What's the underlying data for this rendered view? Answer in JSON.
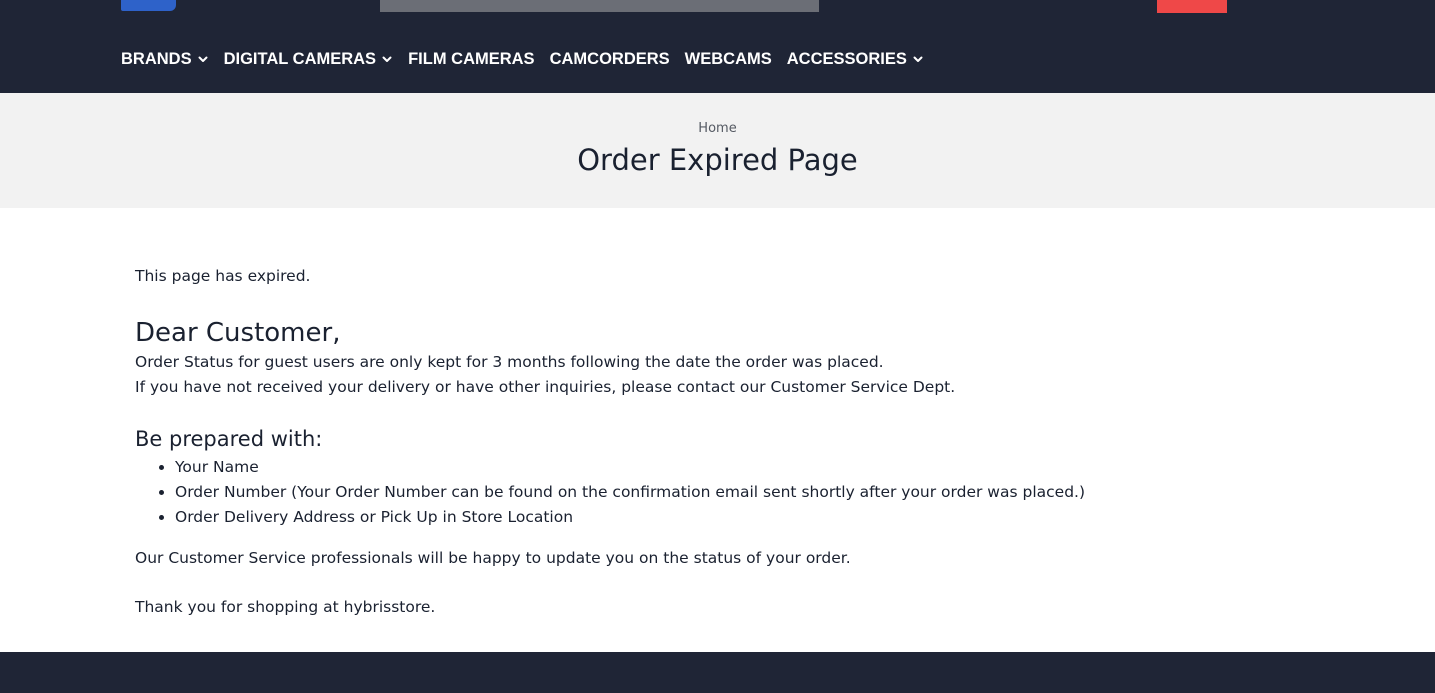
{
  "nav": {
    "items": [
      {
        "label": "BRANDS",
        "has_dropdown": true
      },
      {
        "label": "DIGITAL CAMERAS",
        "has_dropdown": true
      },
      {
        "label": "FILM CAMERAS",
        "has_dropdown": false
      },
      {
        "label": "CAMCORDERS",
        "has_dropdown": false
      },
      {
        "label": "WEBCAMS",
        "has_dropdown": false
      },
      {
        "label": "ACCESSORIES",
        "has_dropdown": true
      }
    ]
  },
  "breadcrumb": {
    "home": "Home"
  },
  "page": {
    "title": "Order Expired Page"
  },
  "content": {
    "expired": "This page has expired.",
    "greeting": "Dear Customer,",
    "line1": "Order Status for guest users are only kept for 3 months following the date the order was placed.",
    "line2": "If you have not received your delivery or have other inquiries, please contact our Customer Service Dept.",
    "prepared_heading": "Be prepared with:",
    "prepared_items": [
      "Your Name",
      "Order Number (Your Order Number can be found on the confirmation email sent shortly after your order was placed.)",
      "Order Delivery Address or Pick Up in Store Location"
    ],
    "service": "Our Customer Service professionals will be happy to update you on the status of your order.",
    "thanks": "Thank you for shopping at hybrisstore."
  },
  "colors": {
    "header_bg": "#1f2536",
    "hero_bg": "#f2f2f2",
    "accent_red": "#ef4848",
    "logo_blue": "#2e62c9",
    "text": "#1a2130"
  },
  "icons": {
    "dropdown": "chevron-down-icon"
  }
}
